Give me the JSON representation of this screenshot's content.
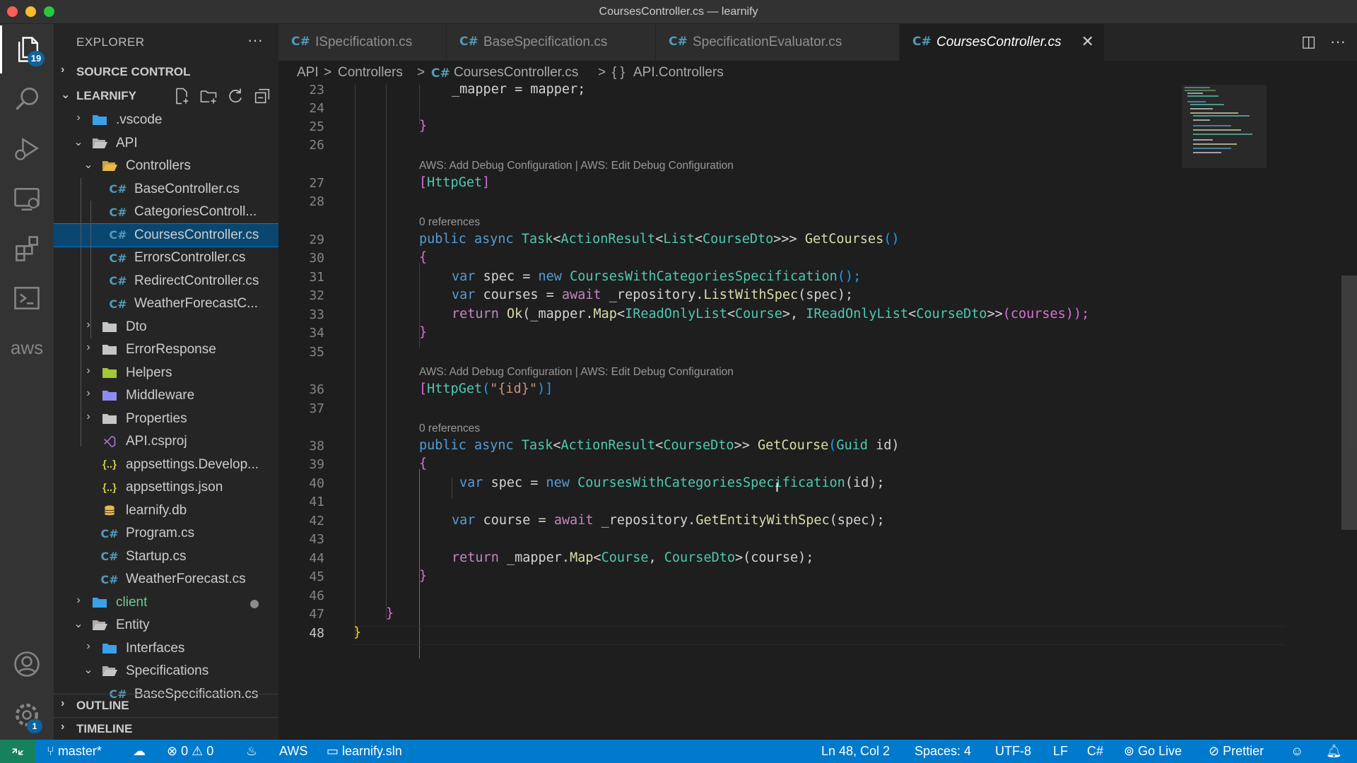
{
  "window": {
    "title": "CoursesController.cs — learnify"
  },
  "activity_bar": {
    "explorer_badge": "19",
    "aws_label": "aws",
    "settings_badge": "1"
  },
  "sidebar": {
    "header": "EXPLORER",
    "more": "···",
    "sections": {
      "source_control": "SOURCE CONTROL",
      "project": "LEARNIFY",
      "outline": "OUTLINE",
      "timeline": "TIMELINE"
    },
    "tree": [
      {
        "label": ".vscode",
        "kind": "folder-vscode",
        "chevron": "›"
      },
      {
        "label": "API",
        "kind": "folder-open",
        "chevron": "⌄"
      },
      {
        "label": "Controllers",
        "kind": "folder-controllers",
        "chevron": "⌄"
      },
      {
        "label": "BaseController.cs",
        "kind": "cs"
      },
      {
        "label": "CategoriesControll...",
        "kind": "cs"
      },
      {
        "label": "CoursesController.cs",
        "kind": "cs"
      },
      {
        "label": "ErrorsController.cs",
        "kind": "cs"
      },
      {
        "label": "RedirectController.cs",
        "kind": "cs"
      },
      {
        "label": "WeatherForecastC...",
        "kind": "cs"
      },
      {
        "label": "Dto",
        "kind": "folder",
        "chevron": "›"
      },
      {
        "label": "ErrorResponse",
        "kind": "folder",
        "chevron": "›"
      },
      {
        "label": "Helpers",
        "kind": "folder-helpers",
        "chevron": "›"
      },
      {
        "label": "Middleware",
        "kind": "folder-middleware",
        "chevron": "›"
      },
      {
        "label": "Properties",
        "kind": "folder",
        "chevron": "›"
      },
      {
        "label": "API.csproj",
        "kind": "csproj"
      },
      {
        "label": "appsettings.Develop...",
        "kind": "json"
      },
      {
        "label": "appsettings.json",
        "kind": "json"
      },
      {
        "label": "learnify.db",
        "kind": "db"
      },
      {
        "label": "Program.cs",
        "kind": "cs"
      },
      {
        "label": "Startup.cs",
        "kind": "cs"
      },
      {
        "label": "WeatherForecast.cs",
        "kind": "cs"
      },
      {
        "label": "client",
        "kind": "folder-client",
        "chevron": "›"
      },
      {
        "label": "Entity",
        "kind": "folder-open",
        "chevron": "⌄"
      },
      {
        "label": "Interfaces",
        "kind": "folder-interfaces",
        "chevron": "›"
      },
      {
        "label": "Specifications",
        "kind": "folder-open",
        "chevron": "⌄"
      },
      {
        "label": "BaseSpecification.cs",
        "kind": "cs"
      }
    ]
  },
  "tabs": [
    {
      "lang": "C#",
      "name": "ISpecification.cs"
    },
    {
      "lang": "C#",
      "name": "BaseSpecification.cs"
    },
    {
      "lang": "C#",
      "name": "SpecificationEvaluator.cs"
    },
    {
      "lang": "C#",
      "name": "CoursesController.cs",
      "close": "✕"
    }
  ],
  "breadcrumbs": {
    "part1": "API",
    "part2": "Controllers",
    "lang": "C#",
    "file": "CoursesController.cs",
    "ns_icon": "{ }",
    "namespace": "API.Controllers",
    "sep": ">"
  },
  "editor": {
    "line_numbers": [
      "23",
      "24",
      "25",
      "26",
      "27",
      "28",
      "29",
      "30",
      "31",
      "32",
      "33",
      "34",
      "35",
      "36",
      "37",
      "38",
      "39",
      "40",
      "41",
      "42",
      "43",
      "44",
      "45",
      "46",
      "47",
      "48"
    ],
    "lens_debug": "AWS: Add Debug Configuration | AWS: Edit Debug Configuration",
    "lens_refs": "0 references",
    "tokens": {
      "l23a": "_mapper = mapper;",
      "l25": "}",
      "l27a": "[",
      "l27b": "HttpGet",
      "l27c": "]",
      "l29_public": "public",
      "l29_async": "async",
      "l29_task": "Task",
      "l29_lt1": "<",
      "l29_ar": "ActionResult",
      "l29_lt2": "<",
      "l29_list": "List",
      "l29_lt3": "<",
      "l29_dto": "CourseDto",
      "l29_gt": ">>>",
      "l29_fn": "GetCourses",
      "l29_paren": "()",
      "l30": "{",
      "l31_var": "var",
      "l31_a": "spec =",
      "l31_new": "new",
      "l31_type": "CoursesWithCategoriesSpecification",
      "l31_end": "();",
      "l32_var": "var",
      "l32_a": "courses =",
      "l32_await": "await",
      "l32_b": "_repository.",
      "l32_fn": "ListWithSpec",
      "l32_c": "(spec);",
      "l33_ret": "return",
      "l33_ok": "Ok",
      "l33_a": "(_mapper.",
      "l33_map": "Map",
      "l33_lt": "<",
      "l33_irl1": "IReadOnlyList",
      "l33_lt2": "<",
      "l33_course": "Course",
      "l33_mid": ">, ",
      "l33_irl2": "IReadOnlyList",
      "l33_lt3": "<",
      "l33_dto": "CourseDto",
      "l33_gt": ">>",
      "l33_end": "(courses));",
      "l34": "}",
      "l36a": "[",
      "l36b": "HttpGet",
      "l36c": "(",
      "l36d": "\"{id}\"",
      "l36e": ")]",
      "l38_public": "public",
      "l38_async": "async",
      "l38_task": "Task",
      "l38_lt": "<",
      "l38_ar": "ActionResult",
      "l38_lt2": "<",
      "l38_dto": "CourseDto",
      "l38_gt": ">>",
      "l38_fn": "GetCourse",
      "l38_p1": "(",
      "l38_guid": "Guid",
      "l38_id": " id)",
      "l39": "{",
      "l40_var": "var",
      "l40_a": "spec =",
      "l40_new": "new",
      "l40_type": "CoursesWithCategoriesSpecification",
      "l40_end": "(id);",
      "l42_var": "var",
      "l42_a": "course =",
      "l42_await": "await",
      "l42_b": "_repository.",
      "l42_fn": "GetEntityWithSpec",
      "l42_c": "(spec);",
      "l44_ret": "return",
      "l44_a": "_mapper.",
      "l44_map": "Map",
      "l44_lt": "<",
      "l44_course": "Course",
      "l44_comma": ", ",
      "l44_dto": "CourseDto",
      "l44_end": ">(course);",
      "l45": "}",
      "l47": "}",
      "l48": "}"
    }
  },
  "statusbar": {
    "branch": "master*",
    "errors": "0",
    "warnings": "0",
    "aws": "AWS",
    "solution": "learnify.sln",
    "position": "Ln 48, Col 2",
    "spaces": "Spaces: 4",
    "encoding": "UTF-8",
    "eol": "LF",
    "language": "C#",
    "golive": "Go Live",
    "prettier": "Prettier"
  }
}
